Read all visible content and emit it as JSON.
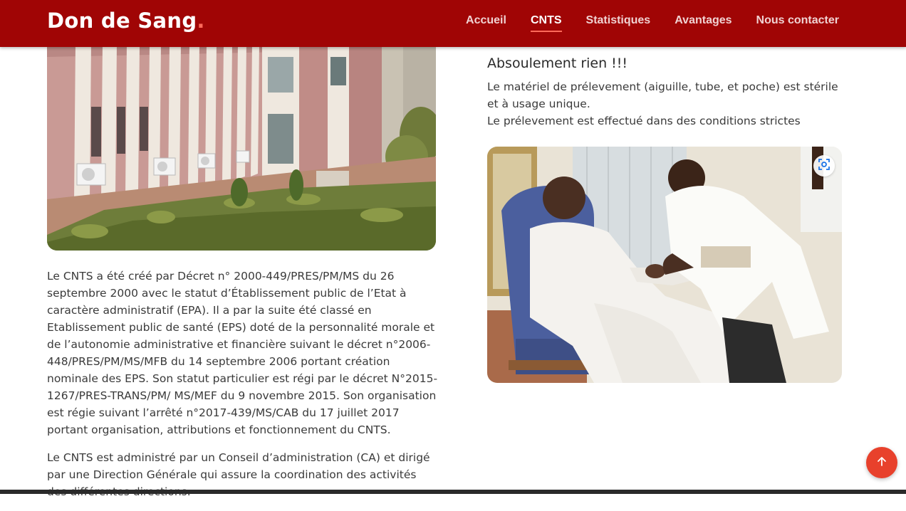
{
  "brand": {
    "name": "Don de Sang",
    "dot": "."
  },
  "nav": {
    "items": [
      {
        "label": "Accueil",
        "active": false
      },
      {
        "label": "CNTS",
        "active": true
      },
      {
        "label": "Statistiques",
        "active": false
      },
      {
        "label": "Avantages",
        "active": false
      },
      {
        "label": "Nous contacter",
        "active": false
      }
    ]
  },
  "left": {
    "paragraph_1": "Le CNTS a été créé par Décret n° 2000-449/PRES/PM/MS du 26 septembre 2000 avec le statut d’Établissement public de l’Etat à caractère administratif (EPA). Il a par la suite été classé en Etablissement public de santé (EPS) doté de la personnalité morale et de l’autonomie administrative et financière suivant le décret n°2006-448/PRES/PM/MS/MFB du 14 septembre 2006 portant création nominale des EPS. Son statut particulier est régi par le décret N°2015-1267/PRES-TRANS/PM/ MS/MEF du 9 novembre 2015. Son organisation est régie suivant l’arrêté n°2017-439/MS/CAB du 17 juillet 2017 portant organisation, attributions et fonctionnement du CNTS.",
    "paragraph_2": "Le CNTS est administré par un Conseil d’administration (CA) et dirigé par une Direction Générale qui assure la coordination des activités des différentes directions."
  },
  "right": {
    "title": "Absoulement rien !!!",
    "line_1": "Le matériel de prélevement (aiguille, tube, et poche) est stérile et à usage unique.",
    "line_2": "Le prélevement est effectué dans des conditions strictes"
  },
  "colors": {
    "navbar": "#a00505",
    "accent": "#e8412c",
    "brand_dot": "#ff6a5a"
  },
  "icons": {
    "lens": "visual-search-icon",
    "to_top": "arrow-up-icon"
  }
}
